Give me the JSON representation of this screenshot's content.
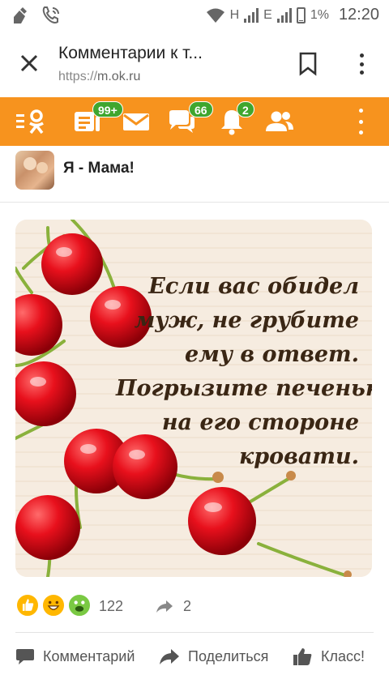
{
  "status_bar": {
    "network_h": "H",
    "network_e": "E",
    "battery": "1%",
    "time": "12:20"
  },
  "browser": {
    "title": "Комментарии к т...",
    "url_scheme": "https://",
    "url_host": "m.ok.ru"
  },
  "toolbar": {
    "badges": {
      "feed": "99+",
      "discussions": "66",
      "notifications": "2"
    },
    "colors": {
      "bar": "#f7931e",
      "badge": "#3fa62e"
    }
  },
  "group": {
    "name": "Я - Мама!"
  },
  "post": {
    "caption_lines": [
      "Если вас обидел",
      "муж, не грубите",
      "ему в ответ.",
      "Погрызите печеньки",
      "на его стороне",
      "кровати."
    ]
  },
  "stats": {
    "reactions_count": "122",
    "shares_count": "2"
  },
  "actions": {
    "comment": "Комментарий",
    "share": "Поделиться",
    "like": "Класс!"
  }
}
